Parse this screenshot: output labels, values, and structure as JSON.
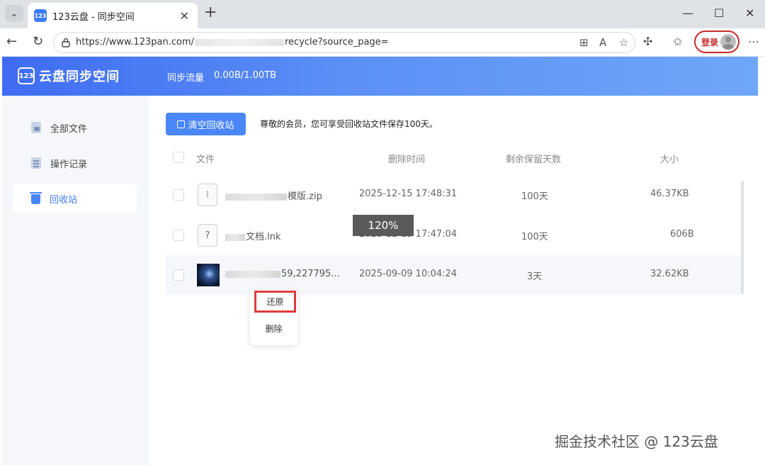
{
  "browser": {
    "tab_title": "123云盘 - 同步空间",
    "favicon_text": "123",
    "url_prefix": "https://www.123pan.com/",
    "url_suffix": "recycle?source_page=",
    "login_label": "登录"
  },
  "header": {
    "logo_badge": "123",
    "logo_text": "云盘同步空间",
    "traffic_label": "同步流量",
    "traffic_value": "0.00B/1.00TB"
  },
  "sidebar": {
    "items": [
      {
        "label": "全部文件"
      },
      {
        "label": "操作记录"
      },
      {
        "label": "回收站"
      }
    ]
  },
  "main": {
    "clear_button": "清空回收站",
    "notice": "尊敬的会员，您可享受回收站文件保存100天。",
    "columns": {
      "name": "文件",
      "deleted_time": "删除时间",
      "days_left": "剩余保留天数",
      "size": "大小"
    },
    "rows": [
      {
        "name": "模版.zip",
        "deleted": "2025-12-15 17:48:31",
        "days": "100天",
        "size": "46.37KB",
        "icon": "zip-file-icon",
        "icon_glyph": "⦚"
      },
      {
        "name": "文档.lnk",
        "deleted": "2025-12-15 17:47:04",
        "days": "100天",
        "size": "606B",
        "icon": "unknown-file-icon",
        "icon_glyph": "?"
      },
      {
        "name": "59,227795...",
        "deleted": "2025-09-09 10:04:24",
        "days": "3天",
        "size": "32.62KB",
        "icon": "image-thumbnail",
        "icon_glyph": ""
      }
    ]
  },
  "zoom_label": "120%",
  "context_menu": {
    "restore": "还原",
    "delete": "删除"
  },
  "watermark": "掘金技术社区 @ 123云盘",
  "colors": {
    "accent": "#4a86f7",
    "highlight": "#e03c3c"
  }
}
